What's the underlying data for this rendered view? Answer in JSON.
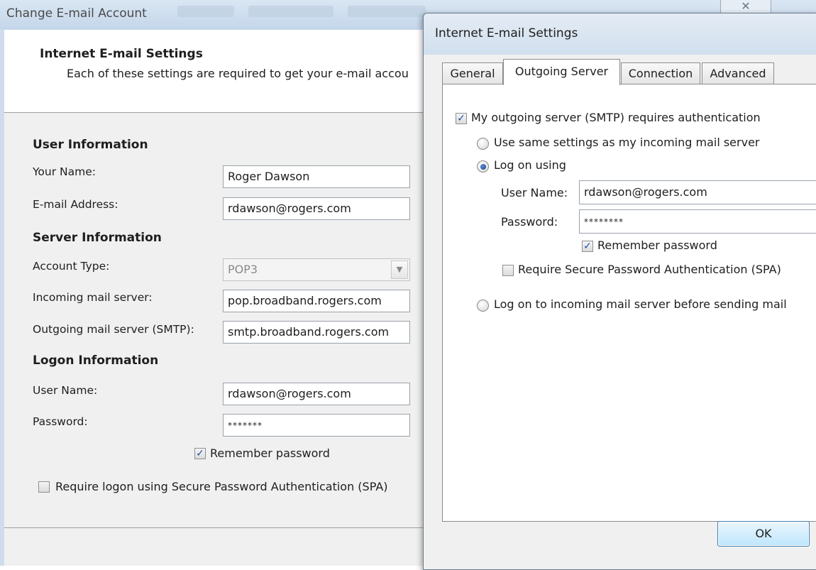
{
  "back_dialog": {
    "title": "Change E-mail Account",
    "close_glyph": "✕",
    "header": {
      "title": "Internet E-mail Settings",
      "subtitle": "Each of these settings are required to get your e-mail accou"
    },
    "sections": {
      "user_info": "User Information",
      "server_info": "Server Information",
      "logon_info": "Logon Information"
    },
    "fields": {
      "your_name": {
        "label": "Your Name:",
        "value": "Roger Dawson"
      },
      "email": {
        "label": "E-mail Address:",
        "value": "rdawson@rogers.com"
      },
      "account_type": {
        "label": "Account Type:",
        "value": "POP3"
      },
      "incoming": {
        "label": "Incoming mail server:",
        "value": "pop.broadband.rogers.com"
      },
      "outgoing": {
        "label": "Outgoing mail server (SMTP):",
        "value": "smtp.broadband.rogers.com"
      },
      "user_name": {
        "label": "User Name:",
        "value": "rdawson@rogers.com"
      },
      "password": {
        "label": "Password:",
        "value": "*******"
      }
    },
    "remember_password": {
      "label": "Remember password",
      "checked": true
    },
    "require_spa": {
      "label": "Require logon using Secure Password Authentication (SPA)",
      "checked": false
    }
  },
  "front_dialog": {
    "title": "Internet E-mail Settings",
    "tabs": [
      {
        "label": "General"
      },
      {
        "label": "Outgoing Server"
      },
      {
        "label": "Connection"
      },
      {
        "label": "Advanced"
      }
    ],
    "active_tab": "Outgoing Server",
    "smtp_auth": {
      "label": "My outgoing server (SMTP) requires authentication",
      "checked": true
    },
    "radio_same_settings": {
      "label": "Use same settings as my incoming mail server",
      "selected": false
    },
    "radio_log_on_using": {
      "label": "Log on using",
      "selected": true
    },
    "user_name": {
      "label": "User Name:",
      "value": "rdawson@rogers.com"
    },
    "password": {
      "label": "Password:",
      "value": "********"
    },
    "remember_password": {
      "label": "Remember password",
      "checked": true
    },
    "require_spa": {
      "label": "Require Secure Password Authentication (SPA)",
      "checked": false
    },
    "radio_log_on_incoming": {
      "label": "Log on to incoming mail server before sending mail",
      "selected": false
    },
    "ok_label": "OK"
  },
  "colors": {
    "accent": "#2150a8",
    "titlebar": "#d1dfee",
    "dialog_bg": "#f0f0f0"
  }
}
